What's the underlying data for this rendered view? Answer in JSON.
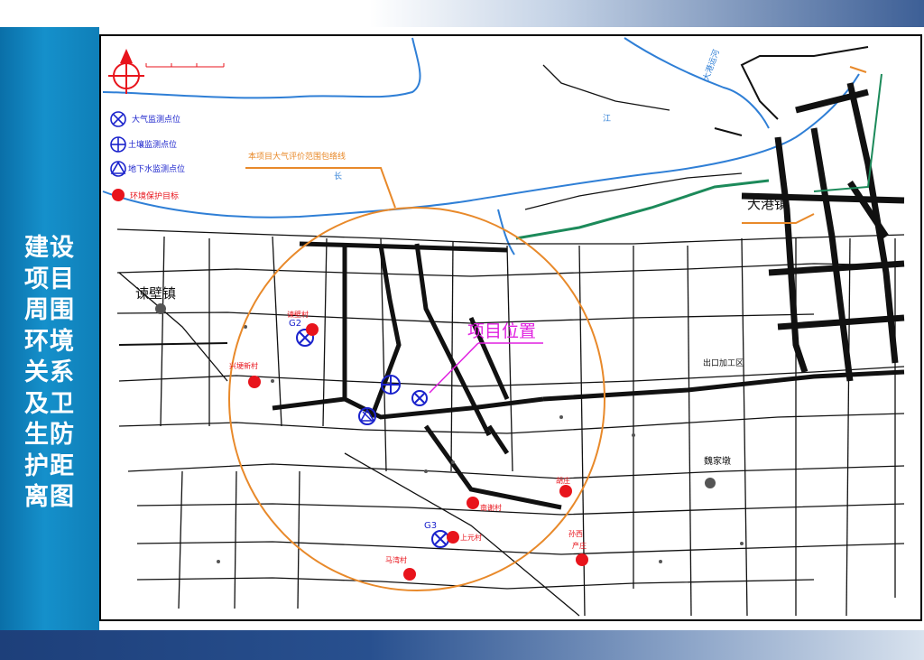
{
  "slide": {
    "side_title": "建设项目周围环境关系及卫生防护距离图"
  },
  "legend": {
    "items": [
      {
        "label": "大气监测点位",
        "icon": "circle-x-icon"
      },
      {
        "label": "土壤监测点位",
        "icon": "circle-cross-icon"
      },
      {
        "label": "地下水监测点位",
        "icon": "circle-triangle-icon"
      },
      {
        "label": "环境保护目标",
        "icon": "red-octagon-icon"
      }
    ],
    "boundary_label": "本项目大气评价范围包络线"
  },
  "map_labels": {
    "river_jiang": "江",
    "river_chang": "长",
    "canal": "大港运河",
    "project_location": "项目位置",
    "town_dagang": "大港镇",
    "town_jianbi": "谏壁镇",
    "town_weijiadun": "魏家墩",
    "district": "出口加工区"
  },
  "monitoring_points": {
    "g2": "G2",
    "g3": "G3"
  },
  "protection_targets": {
    "t1": "谏壁村",
    "t2": "兴埂新村",
    "t3": "南谢村",
    "t4": "上元村",
    "t5": "马湾村",
    "t6": "胡庄",
    "t7": "产庄",
    "t8": "孙西"
  },
  "colors": {
    "side_panel": "#1590cb",
    "river": "#2f7fd6",
    "boundary": "#e8892a",
    "monitor": "#1a22cc",
    "target": "#e8141c",
    "project": "#e020e0"
  }
}
